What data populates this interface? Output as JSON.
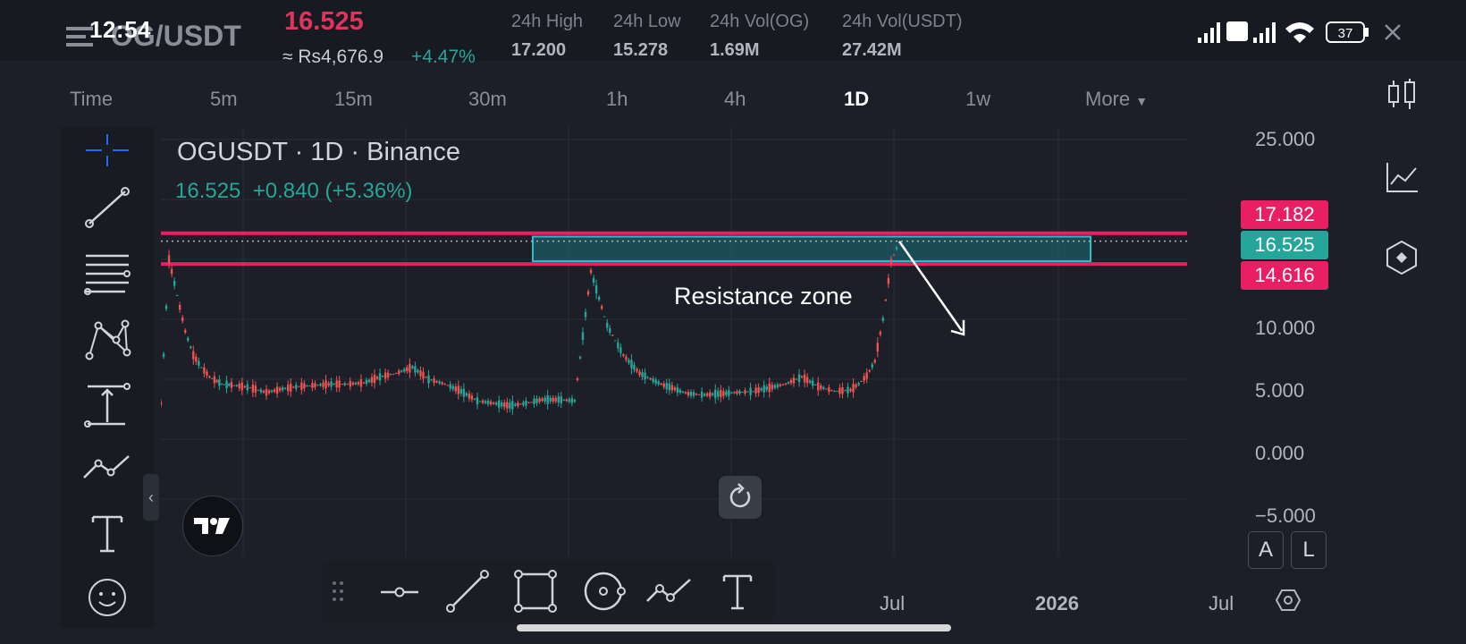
{
  "status_bar": {
    "time": "12:54",
    "battery": "37"
  },
  "header": {
    "pair": "OG/USDT",
    "last_price": "16.525",
    "inr_price": "≈ Rs4,676.9",
    "change_pct": "+4.47%",
    "stats": [
      {
        "label": "24h High",
        "value": "17.200"
      },
      {
        "label": "24h Low",
        "value": "15.278"
      },
      {
        "label": "24h Vol(OG)",
        "value": "1.69M"
      },
      {
        "label": "24h Vol(USDT)",
        "value": "27.42M"
      }
    ]
  },
  "timeframes": [
    "Time",
    "5m",
    "15m",
    "30m",
    "1h",
    "4h",
    "1D",
    "1w",
    "More"
  ],
  "active_timeframe": "1D",
  "chart": {
    "title": "OGUSDT · 1D · Binance",
    "summary_price": "16.525",
    "summary_change": "+0.840 (+5.36%)",
    "annotation": "Resistance zone",
    "y_axis_labels": [
      "25.000",
      "10.000",
      "5.000",
      "0.000",
      "−5.000"
    ],
    "x_axis_labels": [
      "Jul",
      "2026",
      "Jul"
    ],
    "price_tags": [
      {
        "value": "17.182",
        "color": "#e91e63"
      },
      {
        "value": "16.525",
        "color": "#26a69a"
      },
      {
        "value": "14.616",
        "color": "#e91e63"
      }
    ],
    "scale_buttons": [
      "A",
      "L"
    ]
  },
  "chart_data": {
    "type": "line",
    "ylim": [
      -5,
      25
    ],
    "x": [
      0,
      2,
      4,
      6,
      8,
      10,
      12,
      15,
      18,
      22,
      26,
      30,
      34,
      38,
      42,
      46,
      50,
      54,
      58,
      62,
      66,
      70,
      74,
      78,
      82,
      86,
      90,
      94,
      98,
      102,
      106,
      110,
      114,
      118,
      122,
      124,
      126,
      128,
      130,
      134,
      138,
      142,
      146,
      150,
      154,
      158,
      162,
      166,
      170,
      172,
      174,
      176,
      178,
      180,
      182
    ],
    "values": [
      3.0,
      15.0,
      12.0,
      9.0,
      7.0,
      6.0,
      5.2,
      4.6,
      4.5,
      4.3,
      3.9,
      4.2,
      4.4,
      4.5,
      4.6,
      4.6,
      4.7,
      5.2,
      5.5,
      6.0,
      5.0,
      4.6,
      4.0,
      3.2,
      3.0,
      2.8,
      3.0,
      3.3,
      3.3,
      3.2,
      14.0,
      9.5,
      7.0,
      5.5,
      4.8,
      4.5,
      4.3,
      4.0,
      3.8,
      3.7,
      3.8,
      3.9,
      4.0,
      4.3,
      4.6,
      5.2,
      4.4,
      4.0,
      4.1,
      4.6,
      5.3,
      6.5,
      10.0,
      14.8,
      16.5
    ]
  },
  "colors": {
    "resistance_line": "#e91e63",
    "zone_fill": "#1b6f7a",
    "zone_border": "#2fb9cf",
    "up": "#26a69a",
    "down": "#ef5350"
  }
}
